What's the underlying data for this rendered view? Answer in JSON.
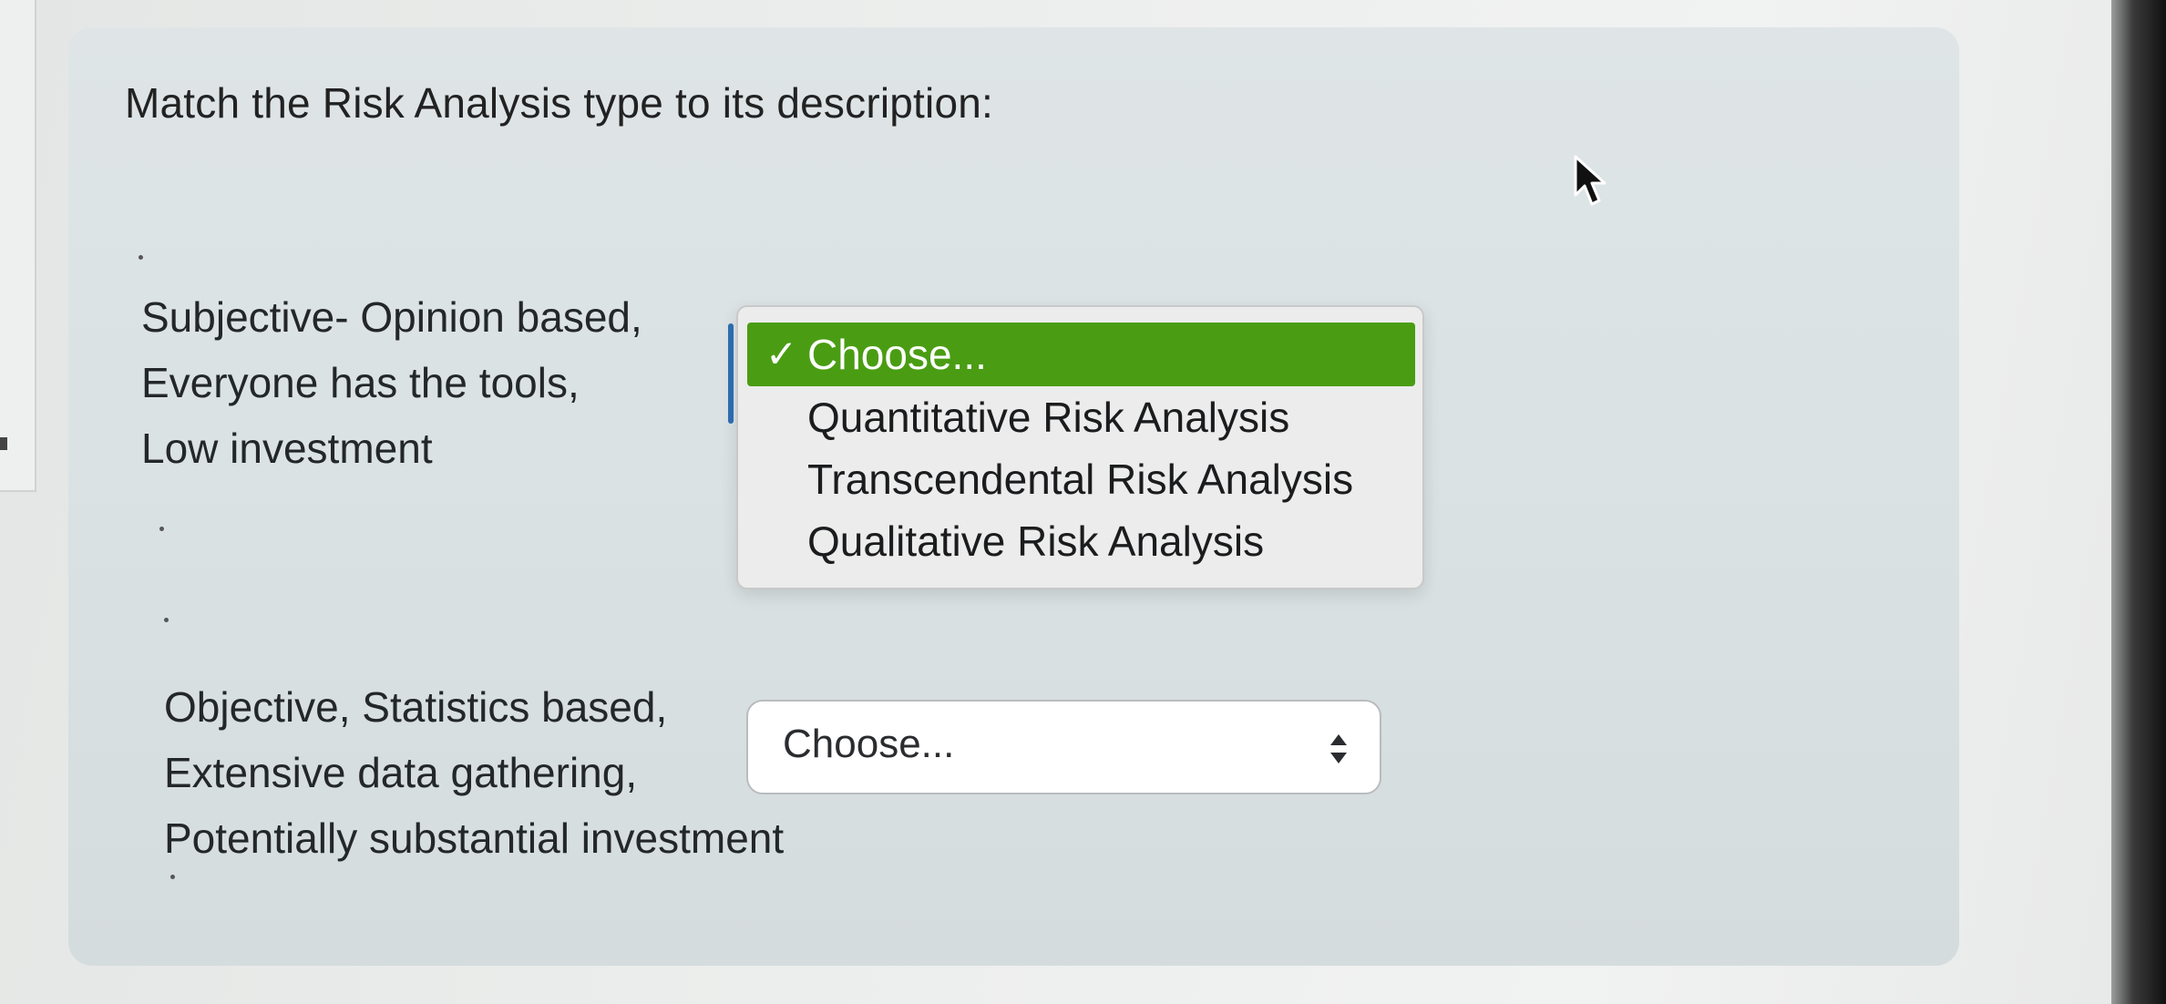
{
  "question": {
    "prompt": "Match the Risk Analysis type to its description:"
  },
  "items": [
    {
      "lines": [
        "Subjective- Opinion based,",
        "Everyone has the tools,",
        "Low investment"
      ],
      "dropdown": {
        "open": true,
        "options": [
          {
            "label": "Choose...",
            "selected": true
          },
          {
            "label": "Quantitative Risk Analysis",
            "selected": false
          },
          {
            "label": "Transcendental Risk Analysis",
            "selected": false
          },
          {
            "label": "Qualitative Risk Analysis",
            "selected": false
          }
        ],
        "check_glyph": "✓"
      }
    },
    {
      "lines": [
        "Objective, Statistics based,",
        "Extensive data gathering,",
        "Potentially substantial investment"
      ],
      "dropdown": {
        "open": false,
        "value": "Choose...",
        "icon": "updown-arrows-icon"
      }
    }
  ],
  "colors": {
    "selected_option_bg": "#4a9d13",
    "select_focus_edge": "#2f6fb3"
  }
}
